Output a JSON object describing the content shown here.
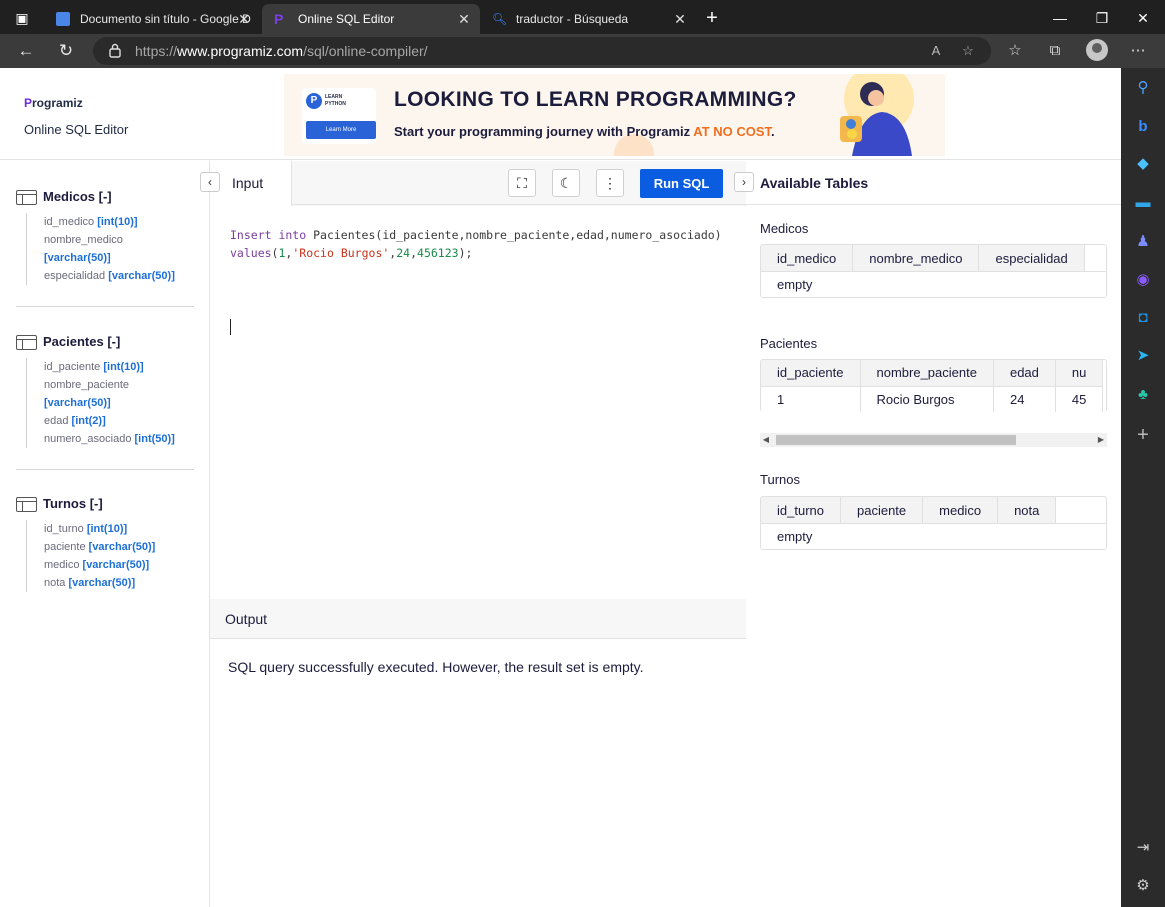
{
  "browser": {
    "tabs": [
      {
        "title": "Documento sin título - Google D",
        "active": false
      },
      {
        "title": "Online SQL Editor",
        "active": true
      },
      {
        "title": "traductor - Búsqueda",
        "active": false
      }
    ],
    "url_prefix": "https://",
    "url_domain": "www.programiz.com",
    "url_path": "/sql/online-compiler/"
  },
  "site": {
    "logo_text": "rogramiz",
    "title": "Online SQL Editor"
  },
  "ad": {
    "badge_line1": "LEARN",
    "badge_line2": "PYTHON",
    "learn_more": "Learn More",
    "headline": "LOOKING TO LEARN PROGRAMMING?",
    "sub_prefix": "Start your programming journey with Programiz ",
    "sub_highlight": "AT NO COST",
    "sub_suffix": "."
  },
  "schema": {
    "tables": [
      {
        "name": "Medicos [-]",
        "columns": [
          {
            "name": "id_medico",
            "type": "[int(10)]"
          },
          {
            "name": "nombre_medico",
            "type": "[varchar(50)]"
          },
          {
            "name": "especialidad",
            "type": "[varchar(50)]"
          }
        ]
      },
      {
        "name": "Pacientes [-]",
        "columns": [
          {
            "name": "id_paciente",
            "type": "[int(10)]"
          },
          {
            "name": "nombre_paciente",
            "type": "[varchar(50)]"
          },
          {
            "name": "edad",
            "type": "[int(2)]"
          },
          {
            "name": "numero_asociado",
            "type": "[int(50)]"
          }
        ]
      },
      {
        "name": "Turnos [-]",
        "columns": [
          {
            "name": "id_turno",
            "type": "[int(10)]"
          },
          {
            "name": "paciente",
            "type": "[varchar(50)]"
          },
          {
            "name": "medico",
            "type": "[varchar(50)]"
          },
          {
            "name": "nota",
            "type": "[varchar(50)]"
          }
        ]
      }
    ]
  },
  "editor": {
    "input_tab": "Input",
    "run_label": "Run SQL",
    "code_line1": {
      "kw1": "Insert into",
      "rest": " Pacientes(id_paciente,nombre_paciente,edad,numero_asociado)"
    },
    "code_line2": {
      "kw": "values",
      "open": "(",
      "n1": "1",
      "c1": ",",
      "str": "'Rocio Burgos'",
      "c2": ",",
      "n2": "24",
      "c3": ",",
      "n3": "456123",
      "close": ");"
    },
    "output_title": "Output",
    "output_text": "SQL query successfully executed. However, the result set is empty."
  },
  "available": {
    "title": "Available Tables",
    "tables": [
      {
        "name": "Medicos",
        "headers": [
          "id_medico",
          "nombre_medico",
          "especialidad"
        ],
        "empty": "empty"
      },
      {
        "name": "Pacientes",
        "headers": [
          "id_paciente",
          "nombre_paciente",
          "edad",
          "nu"
        ],
        "rows": [
          [
            "1",
            "Rocio Burgos",
            "24",
            "45"
          ]
        ]
      },
      {
        "name": "Turnos",
        "headers": [
          "id_turno",
          "paciente",
          "medico",
          "nota"
        ],
        "empty": "empty"
      }
    ]
  },
  "colors": {
    "run_button": "#0a5ce0",
    "type_blue": "#1d6fd6",
    "brand_purple": "#6f2bd6",
    "ad_highlight": "#f06e1f"
  }
}
